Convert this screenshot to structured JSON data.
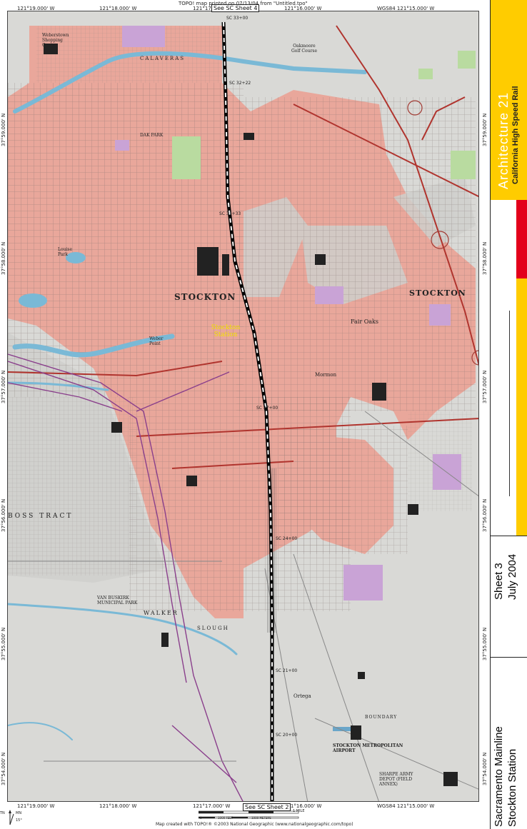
{
  "header": {
    "print_note": "TOPO! map printed on 07/13/04 from \"Untitled.tpo\""
  },
  "coords": {
    "top": [
      "121°19.000' W",
      "121°18.000' W",
      "121°17",
      "121°16.000' W",
      "WGS84 121°15.000' W"
    ],
    "bottom": [
      "121°19.000' W",
      "121°18.000' W",
      "121°17.000' W",
      "121°16.000' W",
      "WGS84 121°15.000' W"
    ],
    "left": [
      "37°59.000' N",
      "37°58.000' N",
      "37°57.000' N",
      "37°56.000' N",
      "37°55.000' N",
      "37°54.000' N"
    ],
    "right": [
      "37°59.000' N",
      "37°58.000' N",
      "37°57.000' N",
      "37°56.000' N",
      "37°55.000' N",
      "37°54.000' N"
    ]
  },
  "sheet_refs": {
    "top": "See SC Sheet 4",
    "bottom": "See SC Sheet 2"
  },
  "map_labels": {
    "city_main": "STOCKTON",
    "city_east": "STOCKTON",
    "station": "Stockton Station",
    "fair_oaks": "Fair Oaks",
    "oakmoore": "Oakmoore Golf Course",
    "dak_park": "DAK PARK",
    "calaveras": "CALAVERAS",
    "boss_tract": "BOSS TRACT",
    "van_buskirk": "VAN BUSKIRK MUNICIPAL PARK",
    "walker": "WALKER",
    "slough": "SLOUGH",
    "airport": "STOCKTON METROPOLITAN AIRPORT",
    "sharpe": "SHARPE ARMY DEPOT (FIELD ANNEX)",
    "ortega": "Ortega",
    "mormon": "Mormon",
    "weber_point": "Weber Point",
    "louise_park": "Louise Park",
    "boundary": "BOUNDARY",
    "shopping": "Weberstown Shopping Center"
  },
  "stations": [
    "SC 33+00",
    "SC 32+22",
    "SC 31+33",
    "SC 27+00",
    "SC 24+00",
    "SC 21+00",
    "SC 20+00"
  ],
  "scale": {
    "mile_label": "1 MILE",
    "ft_labels": [
      "0",
      "1000 FEET",
      "1000 METERS"
    ],
    "north_tn": "TN",
    "north_mn": "MN",
    "declination": "15°"
  },
  "footer": {
    "credit": "Map created with TOPO!® ©2003 National Geographic (www.nationalgeographic.com/topo)"
  },
  "title_block": {
    "architecture": "Architecture 21",
    "project": "California High Speed Rail",
    "sheet": "Sheet 3",
    "date": "July 2004",
    "line1": "Sacramento Mainline",
    "line2": "Stockton Station"
  },
  "colors": {
    "brand_yellow": "#ffcc00",
    "accent_red": "#e3001b",
    "urban_pink": "#eaa89c",
    "rail": "#000000"
  }
}
